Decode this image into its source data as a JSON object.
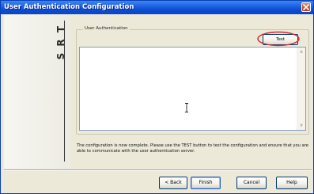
{
  "window": {
    "title": "User Authentication Configuration"
  },
  "logo": {
    "letters": [
      "T",
      "R",
      "S"
    ]
  },
  "group": {
    "label": "User Authentication",
    "test_label": "Test"
  },
  "textarea": {
    "value": ""
  },
  "info": {
    "text": "The configuration is now complete. Please use the TEST button to test the configuration and ensure that you are able to communicate with the user authentication server."
  },
  "buttons": {
    "back": "< Back",
    "finish": "Finish",
    "cancel": "Cancel",
    "help": "Help"
  },
  "colors": {
    "titlebar": "#0a4bd2",
    "highlight_ellipse": "#d8242a",
    "dialog_bg": "#ece9d8"
  }
}
